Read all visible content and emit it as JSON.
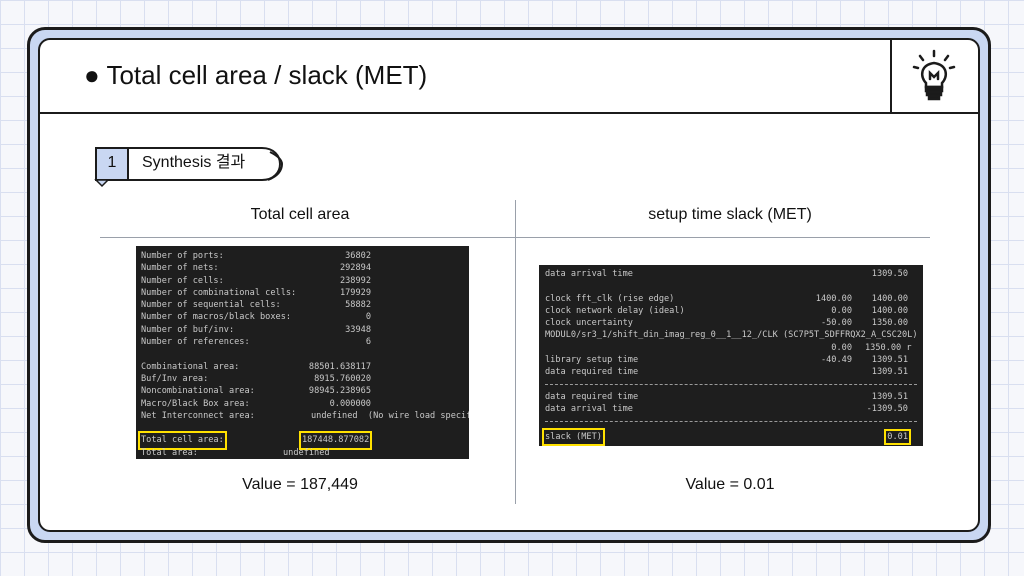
{
  "header": {
    "title": "● Total cell area / slack (MET)",
    "icon": "lightbulb-icon"
  },
  "step": {
    "number": "1",
    "label": "Synthesis 결과"
  },
  "left": {
    "title": "Total cell area",
    "value_text": "Value = 187,449",
    "report": {
      "ports_label": "Number of ports:",
      "ports": "36802",
      "nets_label": "Number of nets:",
      "nets": "292894",
      "cells_label": "Number of cells:",
      "cells": "238992",
      "comb_cells_label": "Number of combinational cells:",
      "comb_cells": "179929",
      "seq_cells_label": "Number of sequential cells:",
      "seq_cells": "58882",
      "macros_label": "Number of macros/black boxes:",
      "macros": "0",
      "bufinv_label": "Number of buf/inv:",
      "bufinv": "33948",
      "refs_label": "Number of references:",
      "refs": "6",
      "comb_area_label": "Combinational area:",
      "comb_area": "88501.638117",
      "bufinv_area_label": "Buf/Inv area:",
      "bufinv_area": "8915.760020",
      "noncomb_area_label": "Noncombinational area:",
      "noncomb_area": "98945.238965",
      "macro_area_label": "Macro/Black Box area:",
      "macro_area": "0.000000",
      "net_area_label": "Net Interconnect area:",
      "net_area": "undefined  (No wire load specified)",
      "total_cell_area_label": "Total cell area:",
      "total_cell_area": "187448.877082",
      "total_area_label": "Total area:",
      "total_area": "undefined"
    }
  },
  "right": {
    "title": "setup time slack (MET)",
    "value_text": "Value = 0.01",
    "report": {
      "arrival_label": "data arrival time",
      "arrival": "1309.50",
      "clock_label": "clock fft_clk (rise edge)",
      "clock_incr": "1400.00",
      "clock_path": "1400.00",
      "network_label": "clock network delay (ideal)",
      "network_incr": "0.00",
      "network_path": "1400.00",
      "uncert_label": "clock uncertainty",
      "uncert_incr": "-50.00",
      "uncert_path": "1350.00",
      "pin_label": "MODUL0/sr3_1/shift_din_imag_reg_0__1__12_/CLK (SC7P5T_SDFFRQX2_A_CSC20L)",
      "pin_incr": "0.00",
      "pin_path": "1350.00 r",
      "setup_label": "library setup time",
      "setup_incr": "-40.49",
      "setup_path": "1309.51",
      "required_label": "data required time",
      "required": "1309.51",
      "required2_label": "data required time",
      "required2": "1309.51",
      "arrival2_label": "data arrival time",
      "arrival2": "-1309.50",
      "slack_label": "slack (MET)",
      "slack": "0.01"
    }
  },
  "colors": {
    "slide_bg": "#c9d7f2",
    "tab_fill": "#c9d7f2",
    "terminal_bg": "#1e1e1e",
    "highlight": "#ffe100"
  }
}
